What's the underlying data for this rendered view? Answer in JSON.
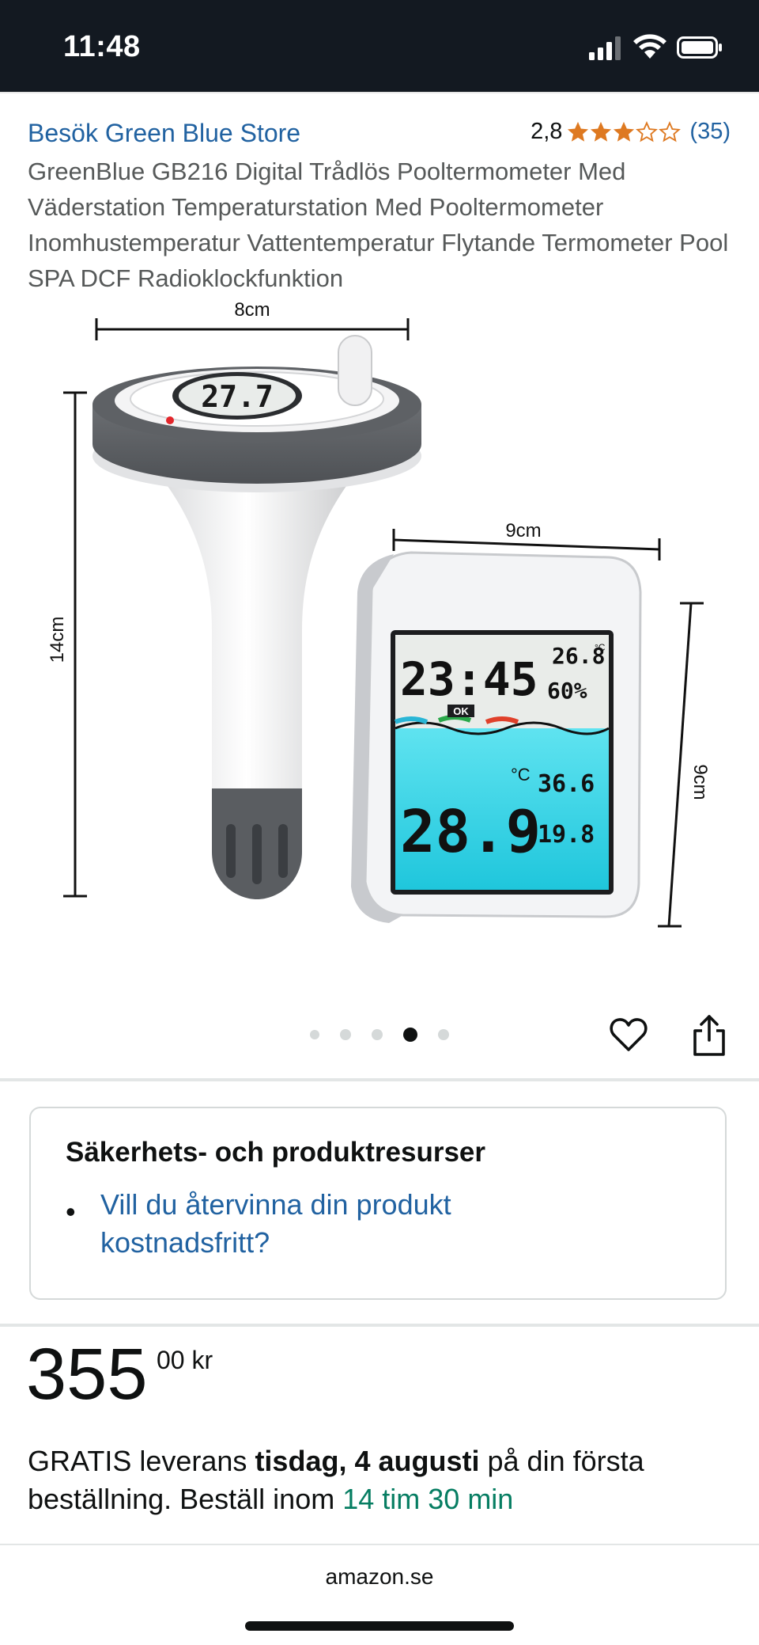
{
  "status_bar": {
    "time": "11:48"
  },
  "store": {
    "link_text": "Besök Green Blue Store"
  },
  "rating": {
    "value": "2,8",
    "stars": 2.8,
    "count": "(35)",
    "star_color": "#de7921"
  },
  "product": {
    "title": "GreenBlue GB216 Digital Trådlös Pooltermometer Med Väderstation Temperaturstation Med Pooltermometer Inomhustemperatur Vattentemperatur Flytande Termometer Pool SPA DCF Radioklockfunktion"
  },
  "gallery": {
    "dims": {
      "width_float": "8cm",
      "height_float": "14cm",
      "width_station": "9cm",
      "height_station": "9cm"
    },
    "float_display": "27.7",
    "station_display": {
      "time": "23:45",
      "indoor_temp": "26.8",
      "indoor_unit": "°C",
      "humidity": "60%",
      "ok_badge": "OK",
      "pool_temp": "28.9",
      "pool_unit": "°C",
      "max_temp": "36.6",
      "min_temp": "19.8"
    },
    "page_count": 5,
    "active_page": 4
  },
  "resources": {
    "title": "Säkerhets- och produktresurser",
    "link": "Vill du återvinna din produkt kostnadsfritt?"
  },
  "price": {
    "whole": "355",
    "fraction_currency": "00 kr"
  },
  "delivery": {
    "prefix": "GRATIS leverans",
    "date": "tisdag, 4 augusti",
    "middle": "på din första beställning. Beställ inom",
    "countdown": "14 tim 30 min"
  },
  "browser": {
    "domain": "amazon.se"
  },
  "colors": {
    "status_bar": "#131921",
    "link": "#2162a1",
    "lcd_cyan": "#34d8e8",
    "countdown": "#067d62"
  }
}
